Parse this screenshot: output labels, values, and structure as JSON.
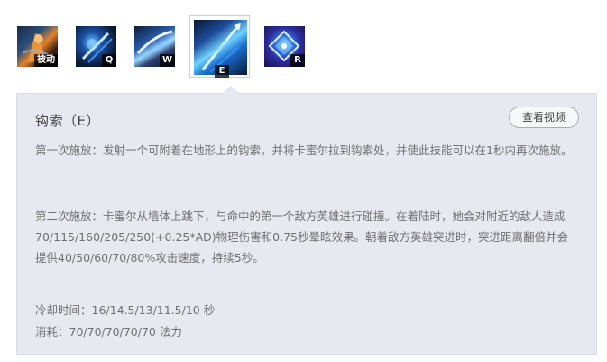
{
  "skills": [
    {
      "key": "passive",
      "label": "被动",
      "icon": "passive-icon"
    },
    {
      "key": "q",
      "label": "Q",
      "icon": "q-icon"
    },
    {
      "key": "w",
      "label": "W",
      "icon": "w-icon"
    },
    {
      "key": "e",
      "label": "E",
      "icon": "e-icon",
      "selected": true
    },
    {
      "key": "r",
      "label": "R",
      "icon": "r-icon"
    }
  ],
  "detail": {
    "title": "钩索（E）",
    "video_button": "查看视频",
    "first_cast": "第一次施放：发射一个可附着在地形上的钩索，并将卡蜜尔拉到钩索处，并使此技能可以在1秒内再次施放。",
    "second_cast": "第二次施放：卡蜜尔从墙体上跳下，与命中的第一个敌方英雄进行碰撞。在着陆时，她会对附近的敌人造成70/115/160/205/250(+0.25*AD)物理伤害和0.75秒晕眩效果。朝着敌方英雄突进时，突进距离翻倍并会提供40/50/60/70/80%攻击速度，持续5秒。",
    "cooldown": "冷却时间：16/14.5/13/11.5/10 秒",
    "cost": "消耗：70/70/70/70/70 法力"
  },
  "colors": {
    "panel_bg": "#e6e9ef",
    "panel_border": "#d8dde6",
    "text": "#707070",
    "title": "#444444"
  }
}
